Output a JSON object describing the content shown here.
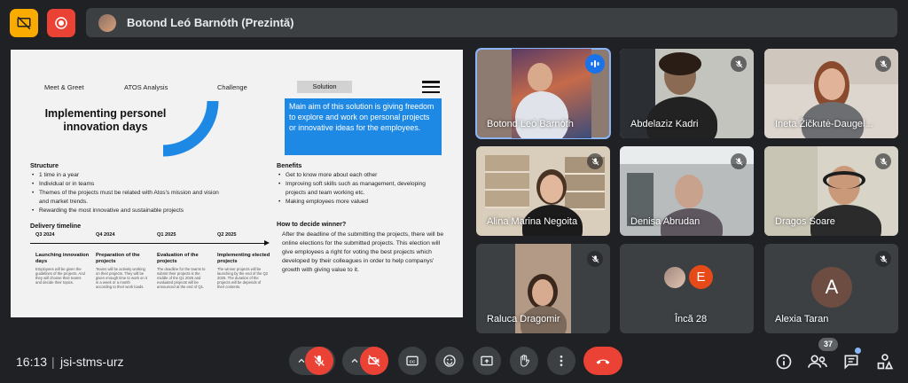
{
  "header": {
    "presenter_label": "Botond Leó Barnóth (Prezintă)"
  },
  "slide": {
    "nav": [
      "Meet & Greet",
      "ATOS Analysis",
      "Challenge",
      "Solution"
    ],
    "title": "Implementing personel innovation days",
    "highlight": "Main aim of this solution is giving freedom to explore and work on personal projects or innovative ideas for the employees.",
    "structure_heading": "Structure",
    "structure_items": [
      "1 time in a year",
      "Individual or in teams",
      "Themes of the projects must be related with Atos's mission and vision and market trends.",
      "Rewarding the most innovative and sustainable projects"
    ],
    "timeline_heading": "Delivery timeline",
    "timeline": [
      {
        "date": "Q3 2024",
        "title": "Launching innovation days",
        "text": "Employees will be given the guidelines of the projects. And they will choose their teams and decide their topics."
      },
      {
        "date": "Q4 2024",
        "title": "Preparation of the projects",
        "text": "Teams will be actively working on their projects. They will be given enough time to work on it in a week or a month according to their work loads."
      },
      {
        "date": "Q1 2025",
        "title": "Evaluation of the projects",
        "text": "The deadline for the teams to submit their projects is the middle of the Q1 2025 and evaluated projects will be announced at the end of Q1."
      },
      {
        "date": "Q2 2025",
        "title": "Implementing elected projects",
        "text": "The winner projects will be launching by the end of the Q2 2025. The duration of the projects will be depends of their contents."
      }
    ],
    "benefits_heading": "Benefits",
    "benefits_items": [
      "Get to know more about each other",
      "Improving soft skills such as management, developing projects and team working etc.",
      "Making employees more valued"
    ],
    "winner_heading": "How to decide winner?",
    "winner_text": "After the deadline of the submitting the projects, there will be online elections for the submitted projects. This election will give employees a right for voting the best projects which developed by their colleagues in order to help companys' growth with giving value to it."
  },
  "participants": [
    {
      "name": "Botond Leó Barnóth",
      "state": "speaking"
    },
    {
      "name": "Abdelaziz Kadri",
      "state": "muted"
    },
    {
      "name": "Ineta Žičkutė-Daugel...",
      "state": "muted"
    },
    {
      "name": "Alina Marina Negoita",
      "state": "muted"
    },
    {
      "name": "Denisa Abrudan",
      "state": "muted"
    },
    {
      "name": "Dragos Soare",
      "state": "muted"
    },
    {
      "name": "Raluca Dragomir",
      "state": "muted"
    },
    {
      "name": "Încă 28",
      "avatar_letter": "E"
    },
    {
      "name": "Alexia Taran",
      "avatar_letter": "A",
      "state": "muted"
    }
  ],
  "footer": {
    "time": "16:13",
    "separator": "|",
    "meeting_code": "jsi-stms-urz",
    "people_count": "37"
  },
  "colors": {
    "background": "#202124",
    "end_call": "#ea4335",
    "accent_blue": "#1e88e5",
    "avatar_e": "#e64a19",
    "avatar_a": "#6d4c41"
  },
  "icons": [
    "present-off-icon",
    "record-icon",
    "mic-off-icon",
    "camera-off-icon",
    "captions-icon",
    "emoji-icon",
    "present-icon",
    "raise-hand-icon",
    "more-icon",
    "end-call-icon",
    "info-icon",
    "people-icon",
    "chat-icon",
    "activities-icon"
  ]
}
